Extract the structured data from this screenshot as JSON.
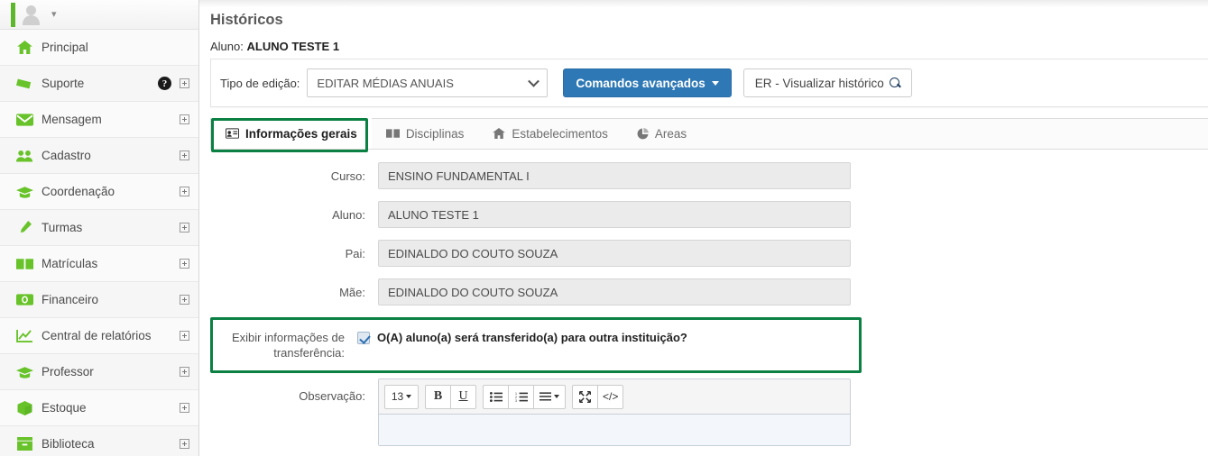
{
  "sidebar": {
    "user": {
      "avatar_icon": "user-silhouette-icon",
      "caret_icon": "chevron-down-icon"
    },
    "items": [
      {
        "label": "Principal",
        "icon": "home-icon",
        "expand": false,
        "help": false
      },
      {
        "label": "Suporte",
        "icon": "ticket-icon",
        "expand": true,
        "help": true
      },
      {
        "label": "Mensagem",
        "icon": "envelope-icon",
        "expand": true,
        "help": false
      },
      {
        "label": "Cadastro",
        "icon": "users-icon",
        "expand": true,
        "help": false
      },
      {
        "label": "Coordenação",
        "icon": "graduation-cap-icon",
        "expand": true,
        "help": false
      },
      {
        "label": "Turmas",
        "icon": "pencil-icon",
        "expand": true,
        "help": false
      },
      {
        "label": "Matrículas",
        "icon": "book-open-icon",
        "expand": true,
        "help": false
      },
      {
        "label": "Financeiro",
        "icon": "money-bill-icon",
        "expand": true,
        "help": false
      },
      {
        "label": "Central de relatórios",
        "icon": "chart-line-icon",
        "expand": true,
        "help": false
      },
      {
        "label": "Professor",
        "icon": "graduation-cap-icon",
        "expand": true,
        "help": false
      },
      {
        "label": "Estoque",
        "icon": "box-icon",
        "expand": true,
        "help": false
      },
      {
        "label": "Biblioteca",
        "icon": "archive-icon",
        "expand": true,
        "help": false
      }
    ],
    "help_glyph": "?"
  },
  "header": {
    "title": "Históricos",
    "student_prefix": "Aluno:",
    "student_name": "ALUNO TESTE 1"
  },
  "toolbar": {
    "edit_type_label": "Tipo de edição:",
    "edit_type_value": "EDITAR MÉDIAS ANUAIS",
    "advanced_commands_label": "Comandos avançados",
    "view_history_label": "ER - Visualizar histórico",
    "view_history_icon": "search-icon",
    "primary_color": "#2e78b5"
  },
  "tabs": [
    {
      "label": "Informações gerais",
      "icon": "id-card-icon",
      "active": true
    },
    {
      "label": "Disciplinas",
      "icon": "book-icon",
      "active": false
    },
    {
      "label": "Estabelecimentos",
      "icon": "home-icon",
      "active": false
    },
    {
      "label": "Areas",
      "icon": "pie-chart-icon",
      "active": false
    }
  ],
  "highlight_color": "#0b8043",
  "form": {
    "fields": [
      {
        "label": "Curso:",
        "value": "ENSINO FUNDAMENTAL I"
      },
      {
        "label": "Aluno:",
        "value": "ALUNO TESTE 1"
      },
      {
        "label": "Pai:",
        "value": "EDINALDO DO COUTO SOUZA"
      },
      {
        "label": "Mãe:",
        "value": "EDINALDO DO COUTO SOUZA"
      }
    ],
    "transfer": {
      "label_line1": "Exibir informações de",
      "label_line2": "transferência:",
      "checkbox_checked": true,
      "checkbox_text": "O(A) aluno(a) será transferido(a) para outra instituição?"
    },
    "observation": {
      "label": "Observação:",
      "toolbar": [
        {
          "name": "font-size-dropdown",
          "text": "13",
          "caret": true
        },
        {
          "name": "bold-button",
          "text": "B"
        },
        {
          "name": "underline-button",
          "text": "U"
        },
        {
          "name": "unordered-list-button"
        },
        {
          "name": "ordered-list-button"
        },
        {
          "name": "align-dropdown",
          "caret": true
        },
        {
          "name": "fullscreen-button"
        },
        {
          "name": "code-view-button",
          "text": "</>"
        }
      ],
      "content": ""
    }
  }
}
